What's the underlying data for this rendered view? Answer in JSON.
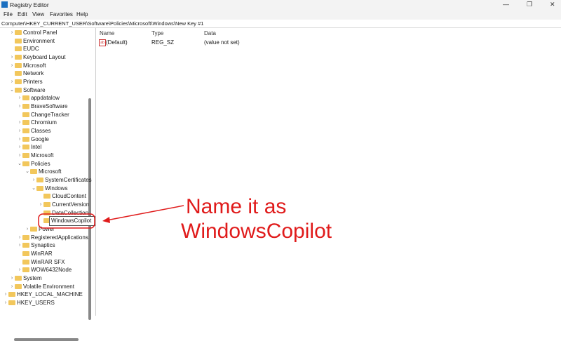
{
  "window": {
    "title": "Registry Editor",
    "controls": [
      "—",
      "❐",
      "✕"
    ]
  },
  "menu": [
    "File",
    "Edit",
    "View",
    "Favorites",
    "Help"
  ],
  "address": "Computer\\HKEY_CURRENT_USER\\Software\\Policies\\Microsoft\\Windows\\New Key #1",
  "tree": [
    {
      "label": "Control Panel",
      "level": 1,
      "chev": ">"
    },
    {
      "label": "Environment",
      "level": 1,
      "chev": ""
    },
    {
      "label": "EUDC",
      "level": 1,
      "chev": ""
    },
    {
      "label": "Keyboard Layout",
      "level": 1,
      "chev": ">"
    },
    {
      "label": "Microsoft",
      "level": 1,
      "chev": ">"
    },
    {
      "label": "Network",
      "level": 1,
      "chev": ""
    },
    {
      "label": "Printers",
      "level": 1,
      "chev": ">"
    },
    {
      "label": "Software",
      "level": 1,
      "chev": "v"
    },
    {
      "label": "appdatalow",
      "level": 2,
      "chev": ">"
    },
    {
      "label": "BraveSoftware",
      "level": 2,
      "chev": ">"
    },
    {
      "label": "ChangeTracker",
      "level": 2,
      "chev": ""
    },
    {
      "label": "Chromium",
      "level": 2,
      "chev": ">"
    },
    {
      "label": "Classes",
      "level": 2,
      "chev": ">"
    },
    {
      "label": "Google",
      "level": 2,
      "chev": ">"
    },
    {
      "label": "Intel",
      "level": 2,
      "chev": ">"
    },
    {
      "label": "Microsoft",
      "level": 2,
      "chev": ">"
    },
    {
      "label": "Policies",
      "level": 2,
      "chev": "v"
    },
    {
      "label": "Microsoft",
      "level": 3,
      "chev": "v"
    },
    {
      "label": "SystemCertificates",
      "level": 4,
      "chev": ">"
    },
    {
      "label": "Windows",
      "level": 4,
      "chev": "v"
    },
    {
      "label": "CloudContent",
      "level": 5,
      "chev": ""
    },
    {
      "label": "CurrentVersion",
      "level": 5,
      "chev": ">"
    },
    {
      "label": "DataCollection",
      "level": 5,
      "chev": ""
    },
    {
      "label": "",
      "level": 5,
      "chev": ""
    },
    {
      "label": "Power",
      "level": 3,
      "chev": ">"
    },
    {
      "label": "RegisteredApplications",
      "level": 2,
      "chev": ">"
    },
    {
      "label": "Synaptics",
      "level": 2,
      "chev": ">"
    },
    {
      "label": "WinRAR",
      "level": 2,
      "chev": ""
    },
    {
      "label": "WinRAR SFX",
      "level": 2,
      "chev": ""
    },
    {
      "label": "WOW6432Node",
      "level": 2,
      "chev": ">"
    },
    {
      "label": "System",
      "level": 1,
      "chev": ">"
    },
    {
      "label": "Volatile Environment",
      "level": 1,
      "chev": ">"
    },
    {
      "label": "HKEY_LOCAL_MACHINE",
      "level": 0,
      "chev": ">"
    },
    {
      "label": "HKEY_USERS",
      "level": 0,
      "chev": ">"
    }
  ],
  "editing_value": "WindowsCopilot",
  "columns": {
    "name": "Name",
    "type": "Type",
    "data": "Data"
  },
  "values": [
    {
      "name": "(Default)",
      "type": "REG_SZ",
      "data": "(value not set)",
      "icon": "ab"
    }
  ],
  "annotation": {
    "line1": "Name it as",
    "line2": "WindowsCopilot",
    "color": "#e01b1b"
  }
}
